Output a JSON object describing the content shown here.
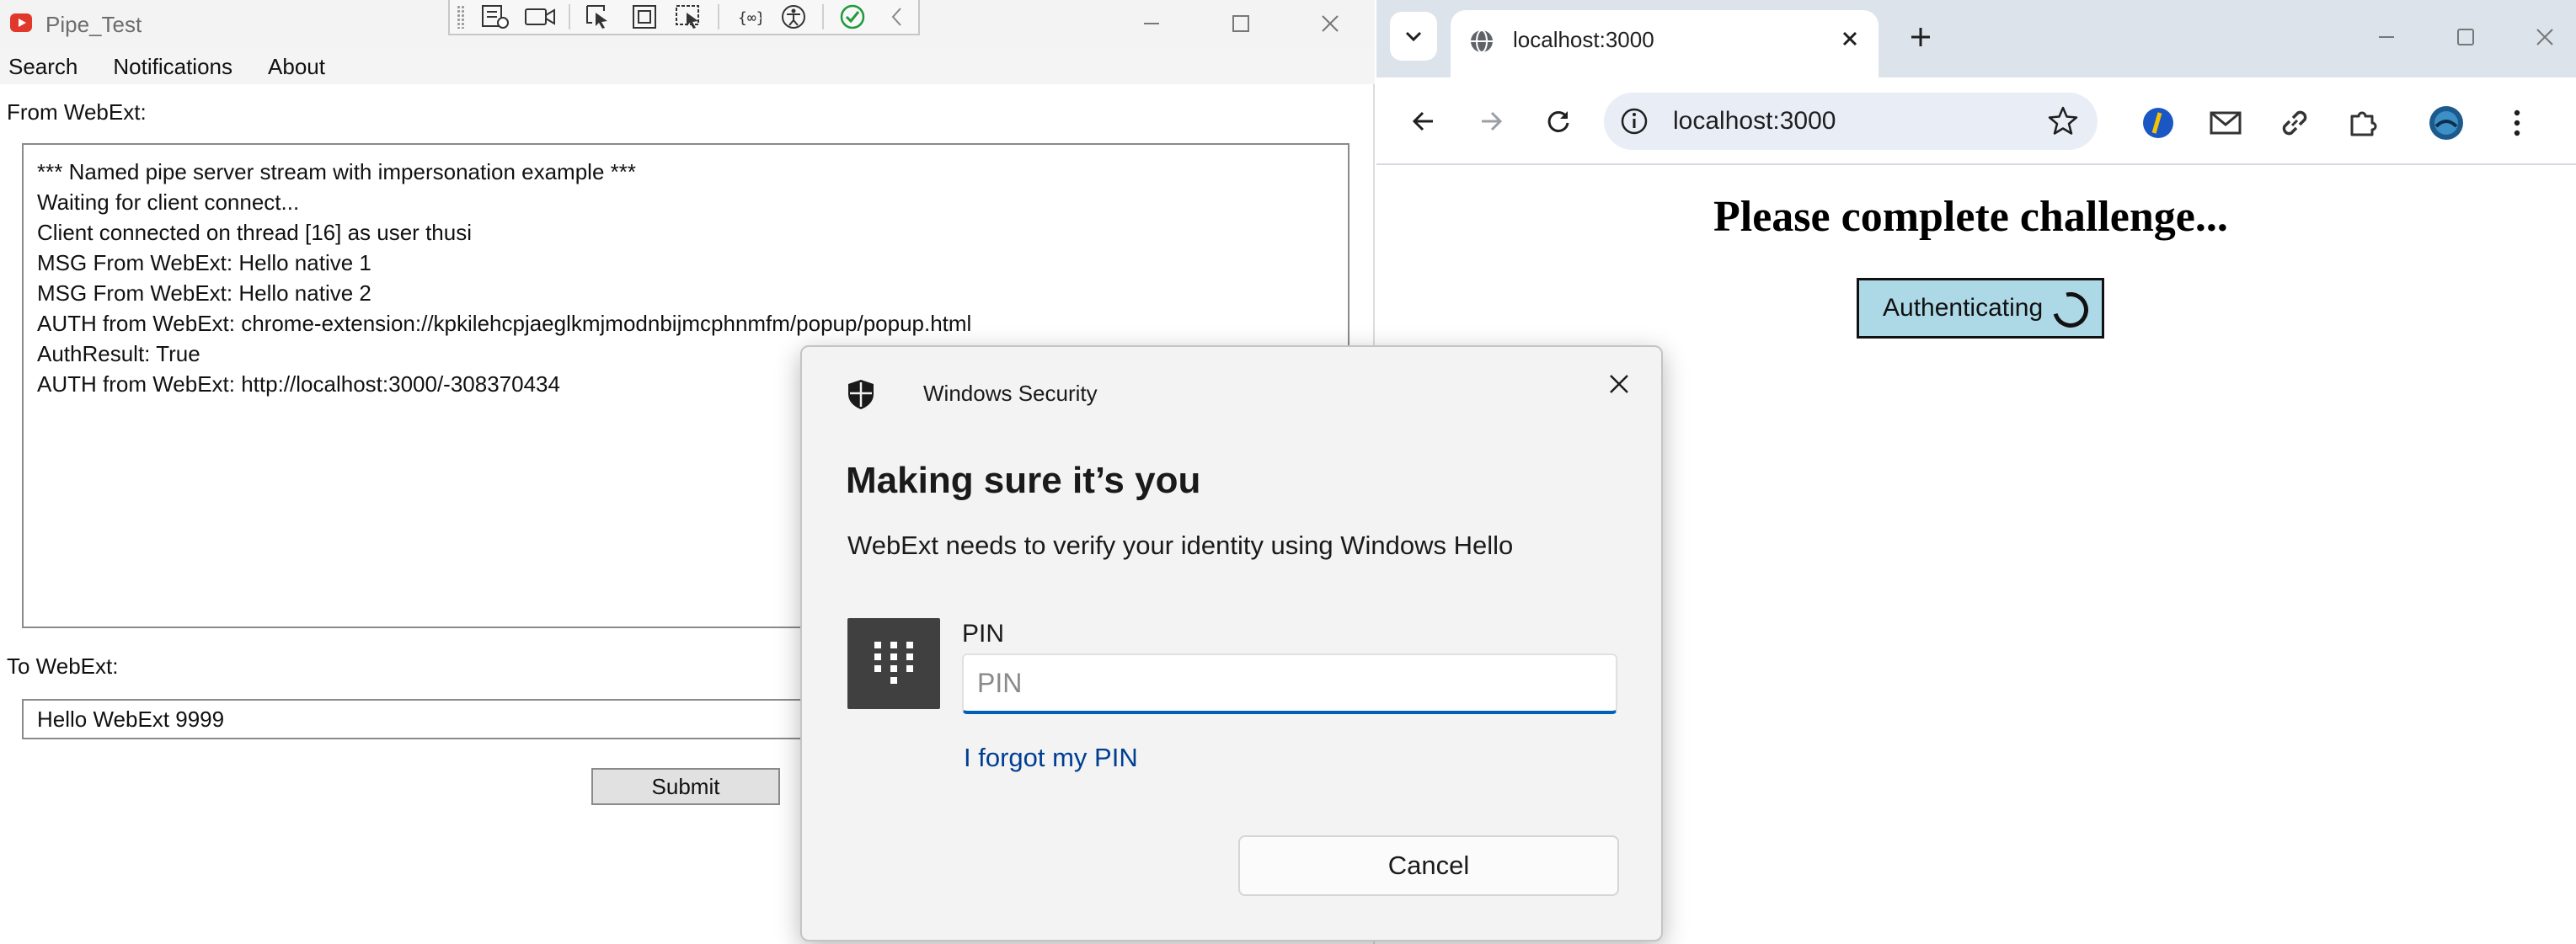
{
  "left_window": {
    "title": "Pipe_Test",
    "menu": [
      "Search",
      "Notifications",
      "About"
    ],
    "from_label": "From WebExt:",
    "output_lines": [
      "*** Named pipe server stream with impersonation example ***",
      "Waiting for client connect...",
      "Client connected on thread [16] as user thusi",
      "MSG From WebExt: Hello native 1",
      "MSG From WebExt: Hello native 2",
      "AUTH from WebExt: chrome-extension://kpkilehcpjaeglkmjmodnbijmcphnmfm/popup/popup.html",
      "AuthResult: True",
      "AUTH from WebExt: http://localhost:3000/-308370434"
    ],
    "to_label": "To WebExt:",
    "input_value": "Hello WebExt 9999",
    "submit_label": "Submit"
  },
  "browser": {
    "tab_title": "localhost:3000",
    "address": "localhost:3000",
    "page_heading": "Please complete challenge...",
    "auth_button_label": "Authenticating"
  },
  "dialog": {
    "app_name": "Windows Security",
    "heading": "Making sure it’s you",
    "description": "WebExt needs to verify your identity using Windows Hello",
    "pin_label": "PIN",
    "pin_placeholder": "PIN",
    "forgot_link": "I forgot my PIN",
    "cancel_label": "Cancel"
  },
  "colors": {
    "accent_blue": "#005fb8",
    "link_blue": "#003e92",
    "auth_button_bg": "#add8e6",
    "chrome_frame": "#dde3ea"
  }
}
